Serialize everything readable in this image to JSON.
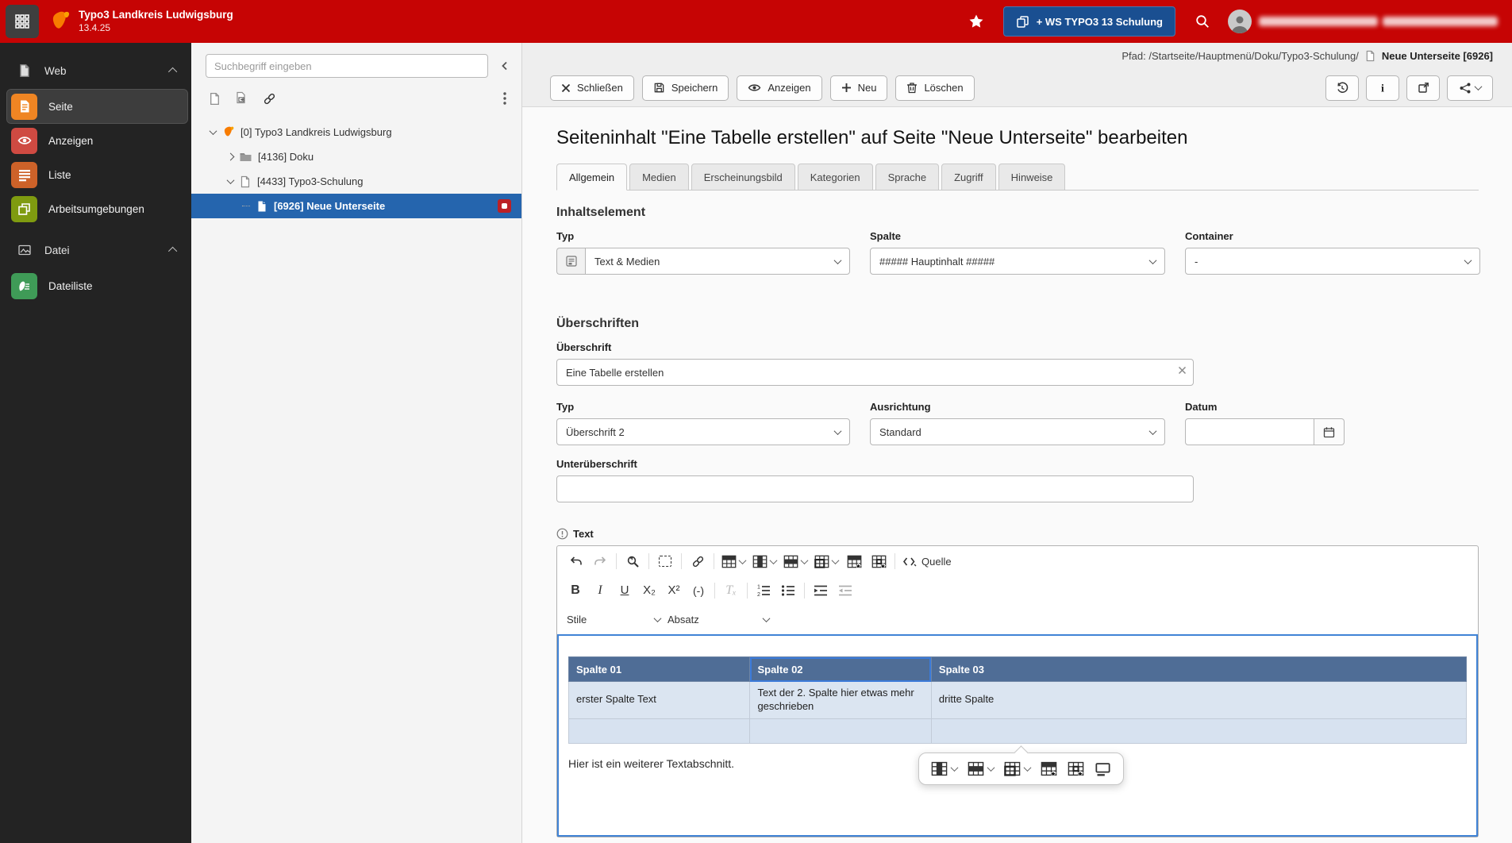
{
  "topbar": {
    "app_title": "Typo3 Landkreis Ludwigsburg",
    "version": "13.4.25",
    "workspace_button_label": "+ WS TYPO3 13 Schulung"
  },
  "sidebar": {
    "groups": [
      {
        "label": "Web",
        "items": [
          {
            "label": "Seite"
          },
          {
            "label": "Anzeigen"
          },
          {
            "label": "Liste"
          },
          {
            "label": "Arbeitsumgebungen"
          }
        ]
      },
      {
        "label": "Datei",
        "items": [
          {
            "label": "Dateiliste"
          }
        ]
      }
    ]
  },
  "pagetree": {
    "search_placeholder": "Suchbegriff eingeben",
    "nodes": [
      {
        "label": "[0] Typo3 Landkreis Ludwigsburg"
      },
      {
        "label": "[4136] Doku"
      },
      {
        "label": "[4433] Typo3-Schulung"
      },
      {
        "label": "[6926] Neue Unterseite"
      }
    ]
  },
  "docheader": {
    "path": "Pfad: /Startseite/Hauptmenü/Doku/Typo3-Schulung/",
    "page_ref": "Neue Unterseite [6926]",
    "buttons": {
      "close": "Schließen",
      "save": "Speichern",
      "view": "Anzeigen",
      "new": "Neu",
      "delete": "Löschen"
    }
  },
  "main": {
    "heading": "Seiteninhalt \"Eine Tabelle erstellen\" auf Seite \"Neue Unterseite\" bearbeiten",
    "tabs": [
      "Allgemein",
      "Medien",
      "Erscheinungsbild",
      "Kategorien",
      "Sprache",
      "Zugriff",
      "Hinweise"
    ]
  },
  "form": {
    "section_content_element": "Inhaltselement",
    "typ_label": "Typ",
    "typ_value": "Text & Medien",
    "spalte_label": "Spalte",
    "spalte_value": "##### Hauptinhalt #####",
    "container_label": "Container",
    "container_value": "-",
    "section_headings": "Überschriften",
    "ueberschrift_label": "Überschrift",
    "ueberschrift_value": "Eine Tabelle erstellen",
    "heading_typ_label": "Typ",
    "heading_typ_value": "Überschrift 2",
    "ausrichtung_label": "Ausrichtung",
    "ausrichtung_value": "Standard",
    "datum_label": "Datum",
    "datum_value": "",
    "unterueberschrift_label": "Unterüberschrift",
    "unterueberschrift_value": "",
    "text_label": "Text"
  },
  "editor": {
    "toolbar": {
      "bold": "B",
      "italic": "I",
      "underline": "U",
      "subscript": "X₂",
      "superscript": "X²",
      "soft_hyphen": "(-)",
      "remove_format": "Tₓ",
      "styles": "Stile",
      "format": "Absatz",
      "source": "Quelle"
    },
    "table": {
      "headers": [
        "Spalte 01",
        "Spalte 02",
        "Spalte 03"
      ],
      "rows": [
        [
          "erster Spalte Text",
          "Text der 2. Spalte hier etwas mehr geschrieben",
          "dritte Spalte"
        ],
        [
          "",
          "",
          ""
        ]
      ]
    },
    "paragraph": "Hier ist ein weiterer Textabschnitt."
  },
  "colors": {
    "topbar_red": "#c60404",
    "selection_blue": "#2565ae",
    "table_header_blue": "#4f6d96",
    "table_row_blue": "#dbe5f1"
  }
}
